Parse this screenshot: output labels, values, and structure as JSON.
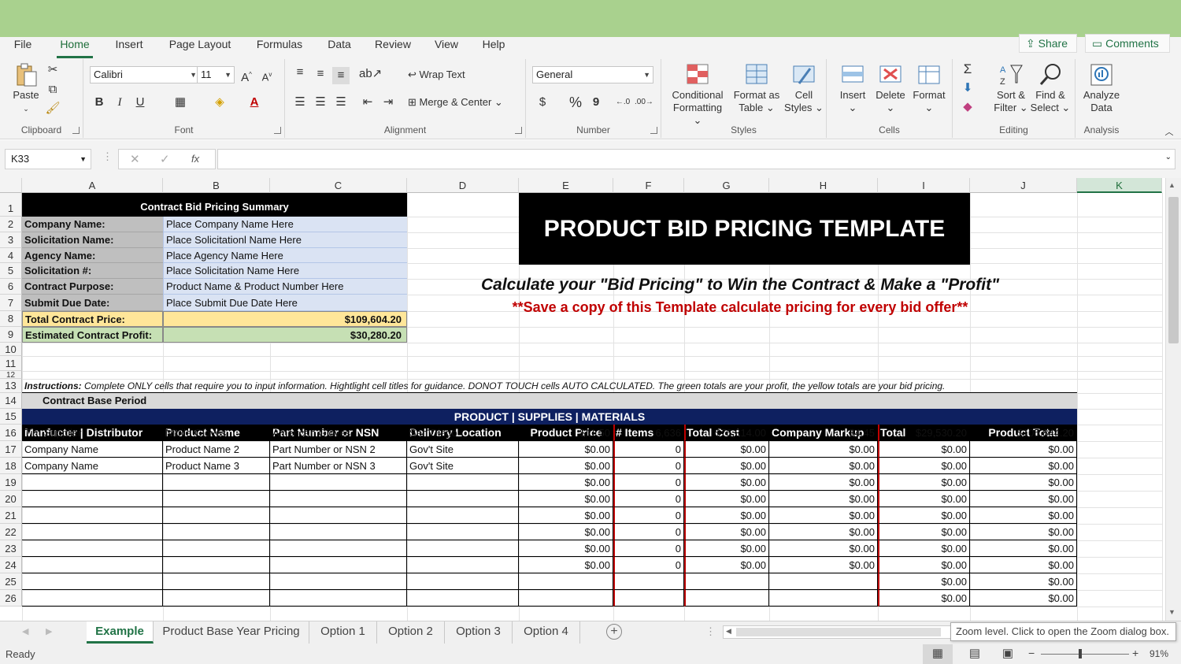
{
  "menu": {
    "tabs": [
      "File",
      "Home",
      "Insert",
      "Page Layout",
      "Formulas",
      "Data",
      "Review",
      "View",
      "Help"
    ],
    "share": "Share",
    "comments": "Comments"
  },
  "ribbon": {
    "clipboard": {
      "label": "Clipboard",
      "paste": "Paste"
    },
    "font": {
      "label": "Font",
      "name": "Calibri",
      "size": "11",
      "bold": "B",
      "italic": "I",
      "underline": "U"
    },
    "alignment": {
      "label": "Alignment",
      "wrap": "Wrap Text",
      "merge": "Merge & Center"
    },
    "number": {
      "label": "Number",
      "format": "General",
      "currency": "$",
      "percent": "%",
      "comma": "9"
    },
    "styles": {
      "label": "Styles",
      "conditional1": "Conditional",
      "conditional2": "Formatting",
      "format_table1": "Format as",
      "format_table2": "Table",
      "cell_styles1": "Cell",
      "cell_styles2": "Styles"
    },
    "cells": {
      "label": "Cells",
      "insert": "Insert",
      "delete": "Delete",
      "format": "Format"
    },
    "editing": {
      "label": "Editing",
      "sort1": "Sort &",
      "sort2": "Filter",
      "find1": "Find &",
      "find2": "Select"
    },
    "analysis": {
      "label": "Analysis",
      "analyze1": "Analyze",
      "analyze2": "Data"
    }
  },
  "formula_bar": {
    "name_box": "K33",
    "fx": "fx",
    "formula": ""
  },
  "columns": [
    "A",
    "B",
    "C",
    "D",
    "E",
    "F",
    "G",
    "H",
    "I",
    "J",
    "K"
  ],
  "rows": [
    "1",
    "2",
    "3",
    "4",
    "5",
    "6",
    "7",
    "8",
    "9",
    "10",
    "11",
    "12",
    "13",
    "14",
    "15",
    "16",
    "17",
    "18",
    "19",
    "20",
    "21",
    "22",
    "23",
    "24",
    "25",
    "26"
  ],
  "summary": {
    "title": "Contract Bid Pricing Summary",
    "items": [
      {
        "label": "Company Name:",
        "value": "Place Company Name Here"
      },
      {
        "label": "Solicitation Name:",
        "value": "Place Solicitationl Name Here"
      },
      {
        "label": "Agency Name:",
        "value": "Place Agency Name Here"
      },
      {
        "label": "Solicitation #:",
        "value": "Place Solicitation Name Here"
      },
      {
        "label": "Contract Purpose:",
        "value": "Product Name & Product Number Here"
      },
      {
        "label": "Submit Due Date:",
        "value": "Place Submit Due Date Here"
      }
    ],
    "total_label": "Total Contract Price:",
    "total_value": "$109,604.20",
    "profit_label": "Estimated Contract Profit:",
    "profit_value": "$30,280.20"
  },
  "banner": {
    "title": "PRODUCT BID PRICING TEMPLATE",
    "subtitle": "Calculate your \"Bid Pricing\" to Win the Contract & Make a \"Profit\"",
    "note": "**Save a copy of this Template calculate pricing for every bid offer**"
  },
  "instructions": {
    "label": "Instructions:",
    "text": "Complete ONLY cells that require you to input information. Hightlight cell titles for guidance. DONOT TOUCH cells AUTO CALCULATED. The green totals are your profit, the yellow totals are your bid pricing."
  },
  "period": "Contract Base Period",
  "section_title": "PRODUCT | SUPPLIES | MATERIALS",
  "table_headers": [
    "Manfucter | Distributor",
    "Product Name",
    "Part Number or NSN",
    "Delivery Location",
    "Product Price",
    "# Items",
    "Total Cost",
    "Company Markup",
    "Total",
    "Product Total"
  ],
  "table_rows": [
    [
      "Tim Supplier",
      "Nitrile Gloves",
      "American Gloves",
      "San Diego",
      "$11.50",
      "6,636",
      "$76,314.00",
      "$4.45",
      "$29,530.20",
      "$105,844.20"
    ],
    [
      "Company Name",
      "Product Name 2",
      "Part Number or NSN 2",
      "Gov't Site",
      "$0.00",
      "0",
      "$0.00",
      "$0.00",
      "$0.00",
      "$0.00"
    ],
    [
      "Company Name",
      "Product Name 3",
      "Part Number or NSN 3",
      "Gov't Site",
      "$0.00",
      "0",
      "$0.00",
      "$0.00",
      "$0.00",
      "$0.00"
    ],
    [
      "",
      "",
      "",
      "",
      "$0.00",
      "0",
      "$0.00",
      "$0.00",
      "$0.00",
      "$0.00"
    ],
    [
      "",
      "",
      "",
      "",
      "$0.00",
      "0",
      "$0.00",
      "$0.00",
      "$0.00",
      "$0.00"
    ],
    [
      "",
      "",
      "",
      "",
      "$0.00",
      "0",
      "$0.00",
      "$0.00",
      "$0.00",
      "$0.00"
    ],
    [
      "",
      "",
      "",
      "",
      "$0.00",
      "0",
      "$0.00",
      "$0.00",
      "$0.00",
      "$0.00"
    ],
    [
      "",
      "",
      "",
      "",
      "$0.00",
      "0",
      "$0.00",
      "$0.00",
      "$0.00",
      "$0.00"
    ],
    [
      "",
      "",
      "",
      "",
      "$0.00",
      "0",
      "$0.00",
      "$0.00",
      "$0.00",
      "$0.00"
    ],
    [
      "",
      "",
      "",
      "",
      "",
      "",
      "",
      "",
      "$0.00",
      "$0.00"
    ],
    [
      "",
      "",
      "",
      "",
      "",
      "",
      "",
      "",
      "$0.00",
      "$0.00"
    ]
  ],
  "sheets": [
    "Example",
    "Product Base Year Pricing",
    "Option 1",
    "Option 2",
    "Option 3",
    "Option 4"
  ],
  "status": {
    "ready": "Ready",
    "zoom": "91%",
    "tooltip": "Zoom level. Click to open the Zoom dialog box."
  },
  "colors": {
    "excel_green": "#217346",
    "title_bar": "#a9d18e",
    "summary_fill": "#dae3f3",
    "label_fill": "#bfbfbf",
    "total_fill": "#ffe699",
    "profit_fill": "#c6e0b4",
    "navy": "#0e2060",
    "note_red": "#c00000"
  }
}
